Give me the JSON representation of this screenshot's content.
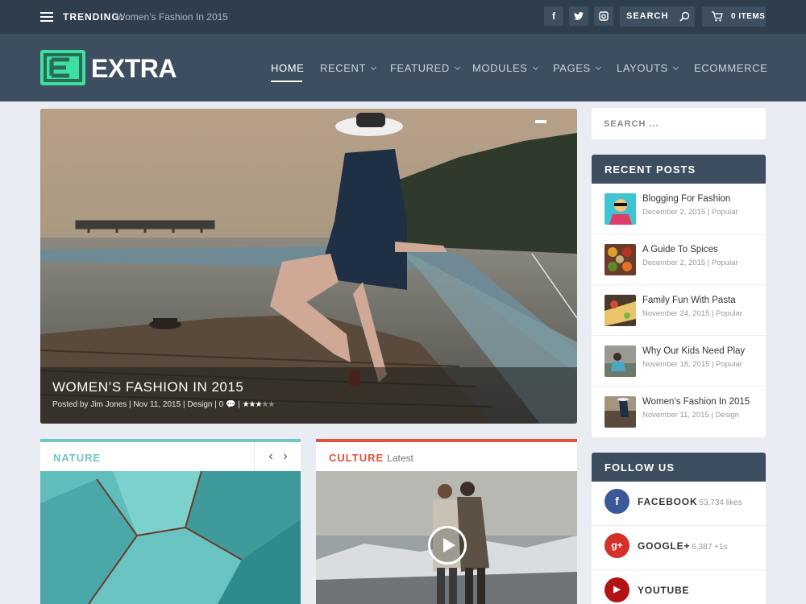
{
  "topbar": {
    "trending_label": "TRENDING:",
    "trending_text": "Women’s Fashion In 2015",
    "social": [
      "f",
      "t",
      "in"
    ],
    "search_label": "SEARCH",
    "cart_label": "0 ITEMS"
  },
  "header": {
    "logo_text": "EXTRA",
    "nav": [
      {
        "label": "HOME",
        "active": true
      },
      {
        "label": "RECENT",
        "dropdown": true
      },
      {
        "label": "FEATURED",
        "dropdown": true
      },
      {
        "label": "MODULES",
        "dropdown": true
      },
      {
        "label": "PAGES",
        "dropdown": true
      },
      {
        "label": "LAYOUTS",
        "dropdown": true
      },
      {
        "label": "ECOMMERCE"
      }
    ]
  },
  "hero": {
    "title": "WOMEN’S FASHION IN 2015",
    "meta_prefix": "Posted by Jim Jones | Nov 11, 2015 | Design | 0",
    "rating": 3,
    "rating_max": 5
  },
  "cards": {
    "nature": {
      "title": "NATURE",
      "accent": "#6fc4c6"
    },
    "culture": {
      "title": "CULTURE",
      "subtitle": "Latest",
      "accent": "#e1523b"
    }
  },
  "sidebar": {
    "search_placeholder": "SEARCH ...",
    "recent_title": "RECENT POSTS",
    "posts": [
      {
        "title": "Blogging For Fashion",
        "meta": "December 2, 2015 | Popular"
      },
      {
        "title": "A Guide To Spices",
        "meta": "December 2, 2015 | Popular"
      },
      {
        "title": "Family Fun With Pasta",
        "meta": "November 24, 2015 | Popular"
      },
      {
        "title": "Why Our Kids Need Play",
        "meta": "November 18, 2015 | Popular"
      },
      {
        "title": "Women’s Fashion In 2015",
        "meta": "November 11, 2015 | Design"
      }
    ],
    "follow_title": "FOLLOW US",
    "follow": [
      {
        "name": "FACEBOOK",
        "count": "53,734 likes",
        "color": "#3b5998",
        "glyph": "f"
      },
      {
        "name": "GOOGLE+",
        "count": "6,387 +1s",
        "color": "#d3312a",
        "glyph": "g+"
      },
      {
        "name": "YOUTUBE",
        "count": "",
        "color": "#b31217",
        "glyph": "▶"
      }
    ]
  },
  "colors": {
    "brand_green": "#3ee0a2",
    "header_bg": "#3d4e61",
    "topbar_bg": "#2f3e4d"
  }
}
